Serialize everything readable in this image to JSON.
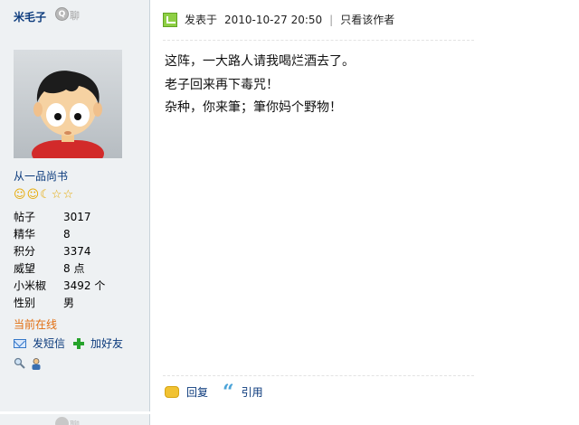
{
  "user": {
    "name": "米毛子",
    "chat_label": "聊",
    "rank": "从一品尚书",
    "stats": [
      {
        "label": "帖子",
        "value": "3017"
      },
      {
        "label": "精华",
        "value": "8"
      },
      {
        "label": "积分",
        "value": "3374"
      },
      {
        "label": "威望",
        "value": "8 点"
      },
      {
        "label": "小米椒",
        "value": "3492 个"
      },
      {
        "label": "性别",
        "value": "男"
      }
    ],
    "online_status": "当前在线",
    "send_message": "发短信",
    "add_friend": "加好友"
  },
  "post": {
    "posted_label": "发表于",
    "date": "2010-10-27 20:50",
    "separator": "|",
    "author_only": "只看该作者",
    "lines": [
      "这阵，一大路人请我喝烂酒去了。",
      "老子回来再下毒咒！",
      "杂种，你来筆；筆你妈个野物！"
    ],
    "reply": "回复",
    "quote": "引用"
  },
  "colors": {
    "sidebar_bg": "#eef1f3",
    "link_blue": "#0b3a7c",
    "online_orange": "#e26e10"
  }
}
